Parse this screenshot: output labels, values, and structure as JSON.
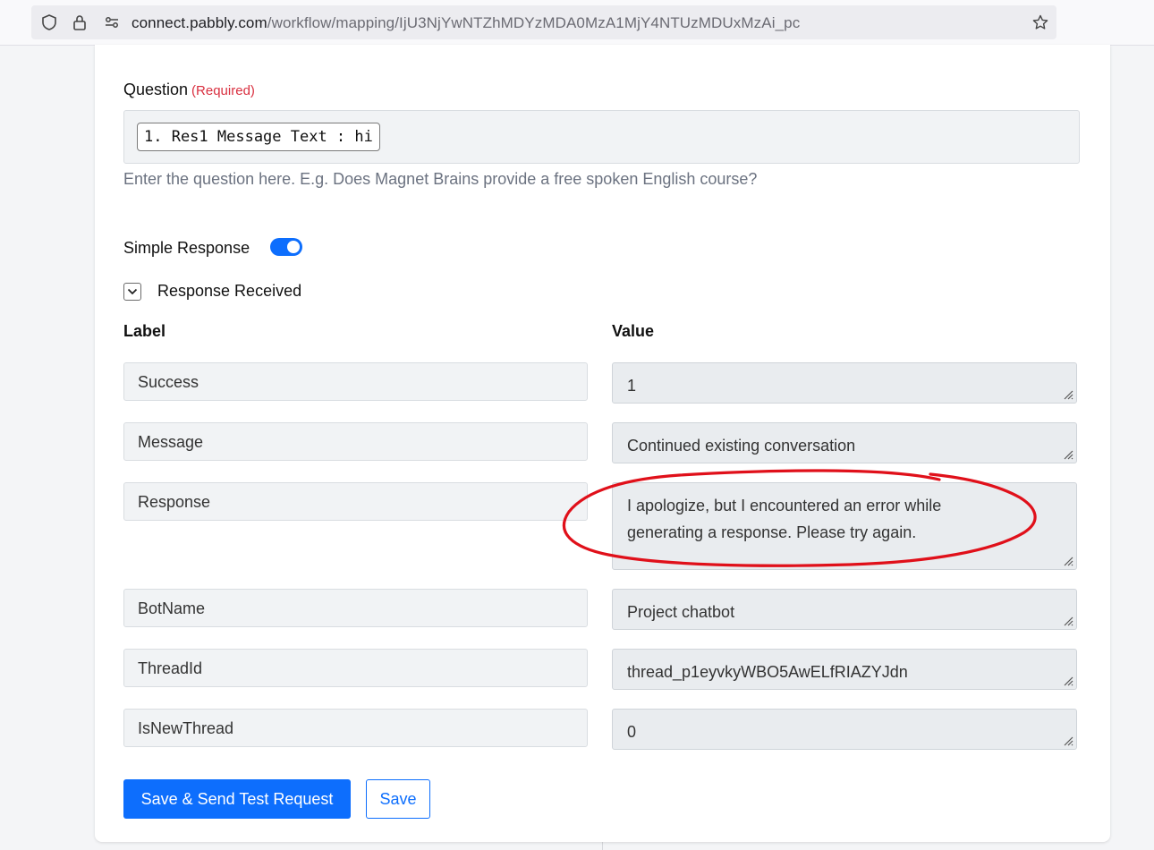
{
  "browser": {
    "url_host": "connect.pabbly.com",
    "url_path": "/workflow/mapping/IjU3NjYwNTZhMDYzMDA0MzA1MjY4NTUzMDUxMzAi_pc"
  },
  "question": {
    "label": "Question",
    "required_text": "(Required)",
    "chip": "1. Res1 Message Text : hi",
    "help": "Enter the question here. E.g. Does Magnet Brains provide a free spoken English course?"
  },
  "simple_response": {
    "label": "Simple Response",
    "enabled": true
  },
  "response_received": {
    "label": "Response Received"
  },
  "columns": {
    "label": "Label",
    "value": "Value"
  },
  "rows": [
    {
      "label": "Success",
      "value": "1"
    },
    {
      "label": "Message",
      "value": "Continued existing conversation"
    },
    {
      "label": "Response",
      "value": "I apologize, but I encountered an error while generating a response. Please try again."
    },
    {
      "label": "BotName",
      "value": "Project chatbot"
    },
    {
      "label": "ThreadId",
      "value": "thread_p1eyvkyWBO5AwELfRIAZYJdn"
    },
    {
      "label": "IsNewThread",
      "value": "0"
    }
  ],
  "buttons": {
    "save_send": "Save & Send Test Request",
    "save": "Save"
  },
  "colors": {
    "primary": "#0d6efd",
    "required": "#d93040",
    "annotation": "#e0101a"
  }
}
